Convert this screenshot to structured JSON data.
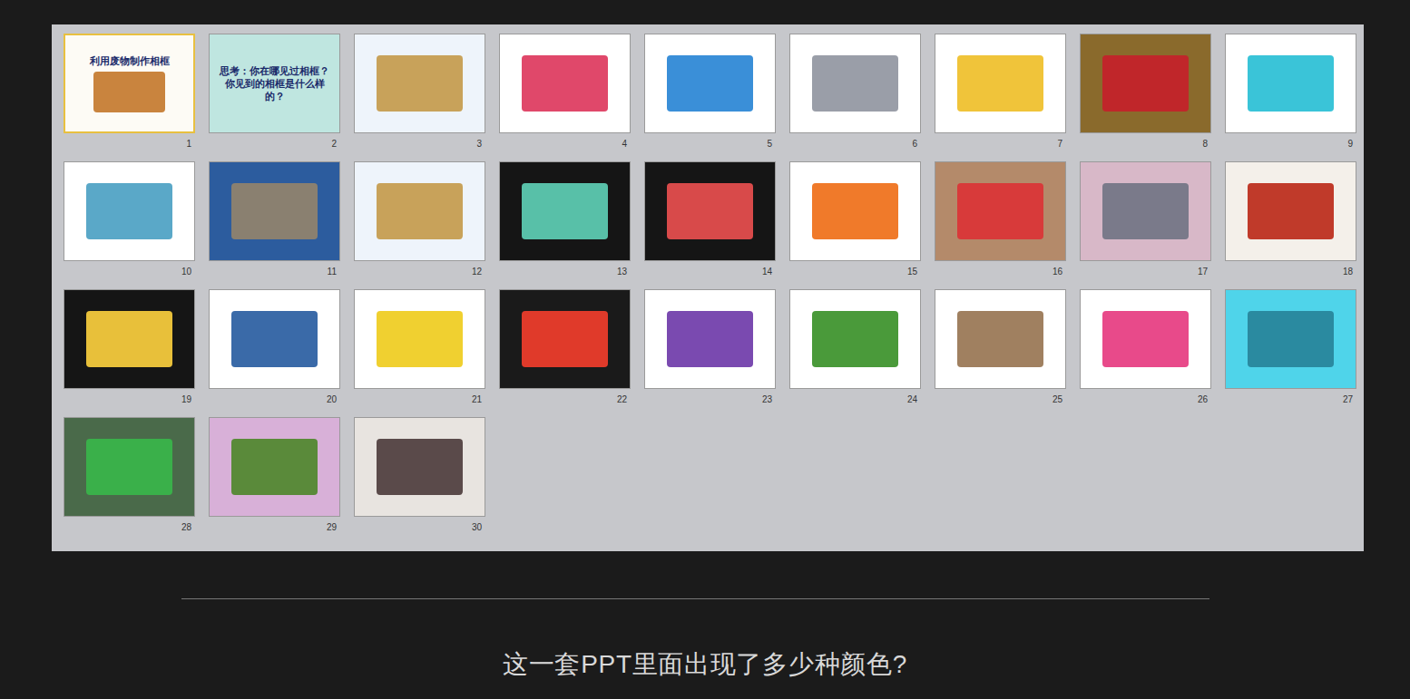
{
  "slides": [
    {
      "number": "1",
      "title": "利用废物制作相框",
      "selected": true,
      "color": "#fdfbf5",
      "inner": "#c9843e"
    },
    {
      "number": "2",
      "title": "思考：你在哪见过相框？你见到的相框是什么样的？",
      "selected": false,
      "color": "#bfe6e0",
      "inner": ""
    },
    {
      "number": "3",
      "title": "",
      "selected": false,
      "color": "#eef4fb",
      "inner": "#c8a25a"
    },
    {
      "number": "4",
      "title": "",
      "selected": false,
      "color": "#ffffff",
      "inner": "#e0486a"
    },
    {
      "number": "5",
      "title": "",
      "selected": false,
      "color": "#ffffff",
      "inner": "#3a8fd8"
    },
    {
      "number": "6",
      "title": "",
      "selected": false,
      "color": "#ffffff",
      "inner": "#9a9ea8"
    },
    {
      "number": "7",
      "title": "",
      "selected": false,
      "color": "#ffffff",
      "inner": "#f0c43a"
    },
    {
      "number": "8",
      "title": "",
      "selected": false,
      "color": "#8a6a2c",
      "inner": "#c0262a"
    },
    {
      "number": "9",
      "title": "",
      "selected": false,
      "color": "#ffffff",
      "inner": "#3ac4d8"
    },
    {
      "number": "10",
      "title": "",
      "selected": false,
      "color": "#ffffff",
      "inner": "#5aa8c8"
    },
    {
      "number": "11",
      "title": "",
      "selected": false,
      "color": "#2c5c9e",
      "inner": "#8a8070"
    },
    {
      "number": "12",
      "title": "",
      "selected": false,
      "color": "#eef4fb",
      "inner": "#c8a25a"
    },
    {
      "number": "13",
      "title": "",
      "selected": false,
      "color": "#151515",
      "inner": "#58c0a8"
    },
    {
      "number": "14",
      "title": "",
      "selected": false,
      "color": "#151515",
      "inner": "#d84a4a"
    },
    {
      "number": "15",
      "title": "",
      "selected": false,
      "color": "#ffffff",
      "inner": "#f07a2a"
    },
    {
      "number": "16",
      "title": "",
      "selected": false,
      "color": "#b48a6a",
      "inner": "#d83a3a"
    },
    {
      "number": "17",
      "title": "",
      "selected": false,
      "color": "#d8b8c8",
      "inner": "#7a7a8a"
    },
    {
      "number": "18",
      "title": "",
      "selected": false,
      "color": "#f4f0ea",
      "inner": "#c03a2a"
    },
    {
      "number": "19",
      "title": "",
      "selected": false,
      "color": "#151515",
      "inner": "#e8c03a"
    },
    {
      "number": "20",
      "title": "",
      "selected": false,
      "color": "#ffffff",
      "inner": "#3a6aa8"
    },
    {
      "number": "21",
      "title": "",
      "selected": false,
      "color": "#ffffff",
      "inner": "#f0d030"
    },
    {
      "number": "22",
      "title": "",
      "selected": false,
      "color": "#1a1a1a",
      "inner": "#e03a2a"
    },
    {
      "number": "23",
      "title": "",
      "selected": false,
      "color": "#ffffff",
      "inner": "#7a4ab0"
    },
    {
      "number": "24",
      "title": "",
      "selected": false,
      "color": "#ffffff",
      "inner": "#4a9a3a"
    },
    {
      "number": "25",
      "title": "",
      "selected": false,
      "color": "#ffffff",
      "inner": "#a08060"
    },
    {
      "number": "26",
      "title": "",
      "selected": false,
      "color": "#ffffff",
      "inner": "#e84a8a"
    },
    {
      "number": "27",
      "title": "",
      "selected": false,
      "color": "#4fd4ea",
      "inner": "#2a8aa0"
    },
    {
      "number": "28",
      "title": "",
      "selected": false,
      "color": "#4a6a4a",
      "inner": "#3ab04a"
    },
    {
      "number": "29",
      "title": "",
      "selected": false,
      "color": "#d8b0d8",
      "inner": "#5a8a3a"
    },
    {
      "number": "30",
      "title": "",
      "selected": false,
      "color": "#e8e4e0",
      "inner": "#5a4a4a"
    }
  ],
  "caption": "这一套PPT里面出现了多少种颜色?"
}
